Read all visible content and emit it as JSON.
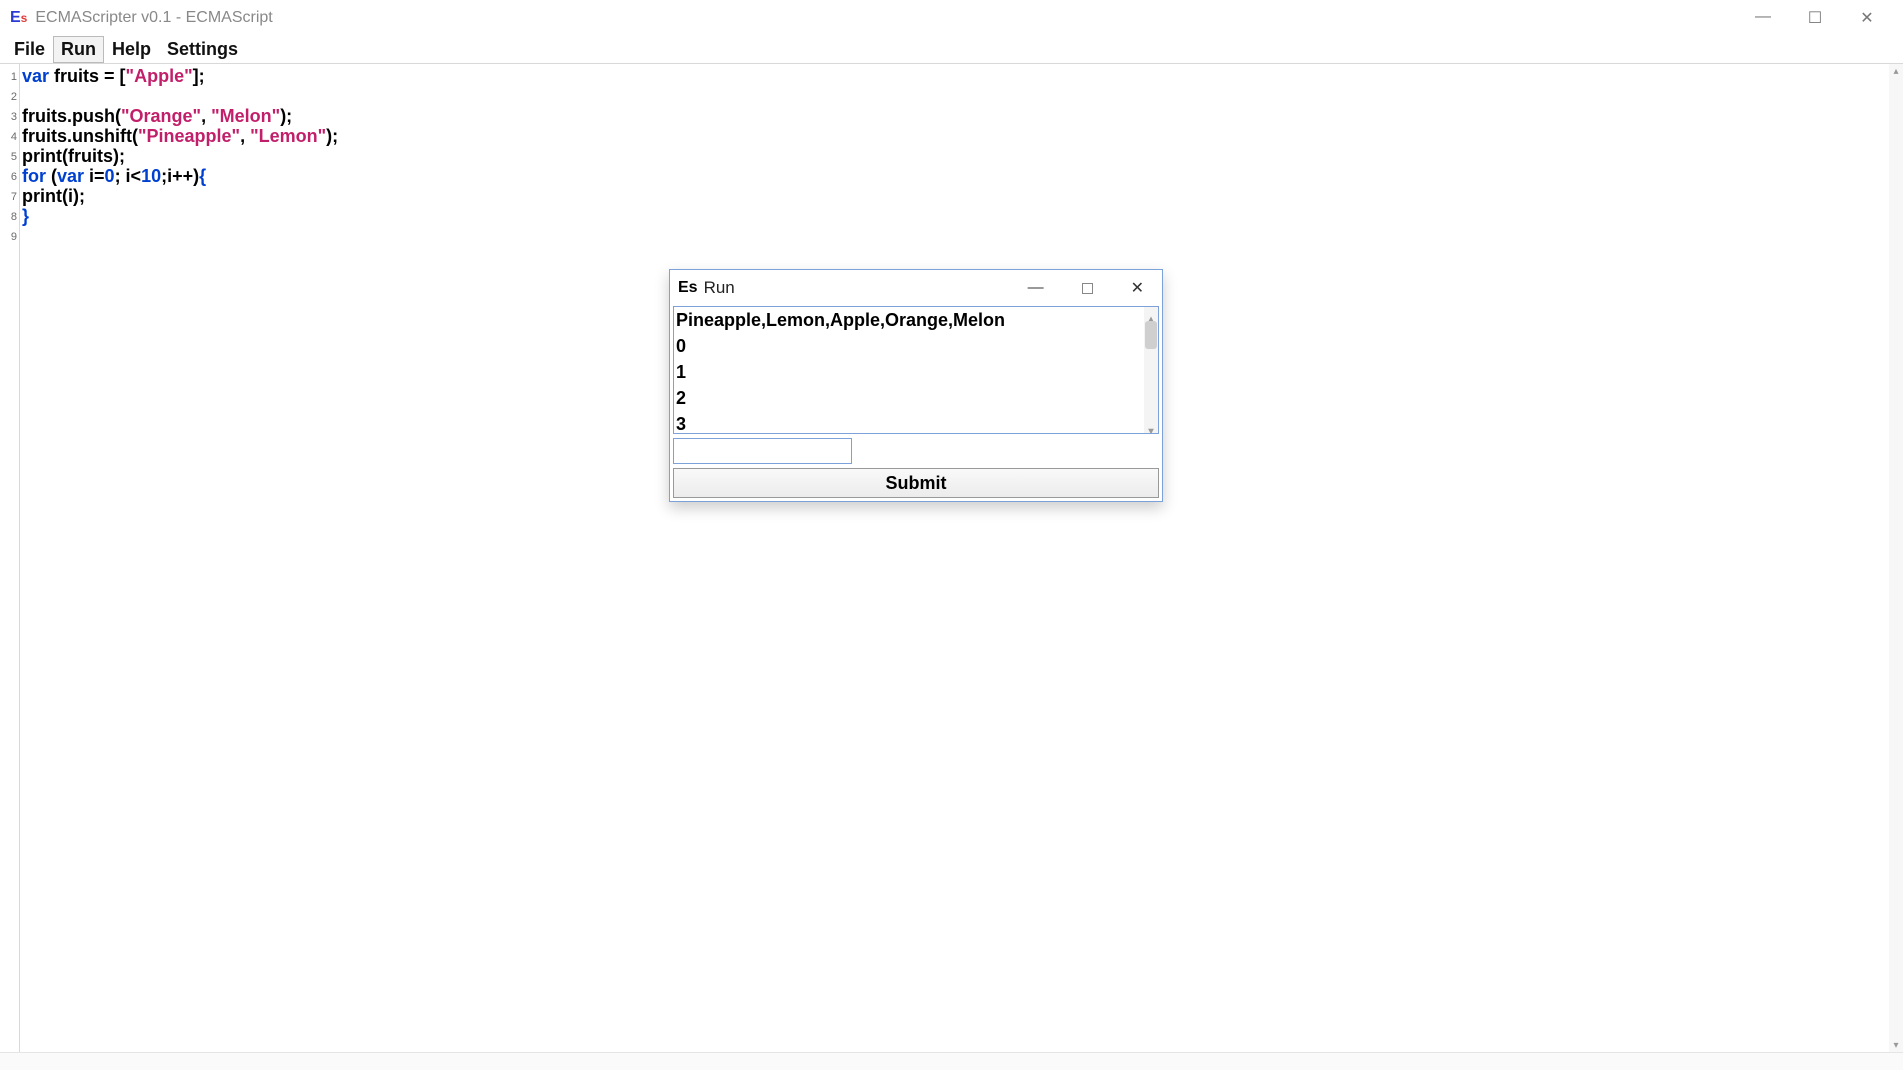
{
  "title": "ECMAScripter v0.1 - ECMAScript",
  "icon": {
    "E": "E",
    "s": "s"
  },
  "menu": {
    "items": [
      "File",
      "Run",
      "Help",
      "Settings"
    ],
    "active": 1
  },
  "code_lines": [
    [
      {
        "cls": "kw",
        "t": "var"
      },
      {
        "cls": "",
        "t": " fruits = ["
      },
      {
        "cls": "str",
        "t": "\"Apple\""
      },
      {
        "cls": "",
        "t": "];"
      }
    ],
    [
      {
        "cls": "",
        "t": ""
      }
    ],
    [
      {
        "cls": "",
        "t": "fruits.push("
      },
      {
        "cls": "str",
        "t": "\"Orange\""
      },
      {
        "cls": "",
        "t": ", "
      },
      {
        "cls": "str",
        "t": "\"Melon\""
      },
      {
        "cls": "",
        "t": ");"
      }
    ],
    [
      {
        "cls": "",
        "t": "fruits.unshift("
      },
      {
        "cls": "str",
        "t": "\"Pineapple\""
      },
      {
        "cls": "",
        "t": ", "
      },
      {
        "cls": "str",
        "t": "\"Lemon\""
      },
      {
        "cls": "",
        "t": ");"
      }
    ],
    [
      {
        "cls": "",
        "t": "print(fruits);"
      }
    ],
    [
      {
        "cls": "kw",
        "t": "for"
      },
      {
        "cls": "",
        "t": " ("
      },
      {
        "cls": "kw",
        "t": "var"
      },
      {
        "cls": "",
        "t": " i="
      },
      {
        "cls": "kw",
        "t": "0"
      },
      {
        "cls": "",
        "t": "; i<"
      },
      {
        "cls": "kw",
        "t": "10"
      },
      {
        "cls": "",
        "t": ";i++)"
      },
      {
        "cls": "kw",
        "t": "{"
      }
    ],
    [
      {
        "cls": "",
        "t": "print(i);"
      }
    ],
    [
      {
        "cls": "kw",
        "t": "}"
      }
    ],
    [
      {
        "cls": "",
        "t": ""
      }
    ]
  ],
  "line_numbers": [
    "1",
    "2",
    "3",
    "4",
    "5",
    "6",
    "7",
    "8",
    "9"
  ],
  "dialog": {
    "title": "Run",
    "output_lines": [
      "Pineapple,Lemon,Apple,Orange,Melon",
      "0",
      "1",
      "2",
      "3"
    ],
    "input_value": "",
    "submit_label": "Submit"
  },
  "window_controls": {
    "min": "—",
    "max": "☐",
    "close": "✕"
  }
}
